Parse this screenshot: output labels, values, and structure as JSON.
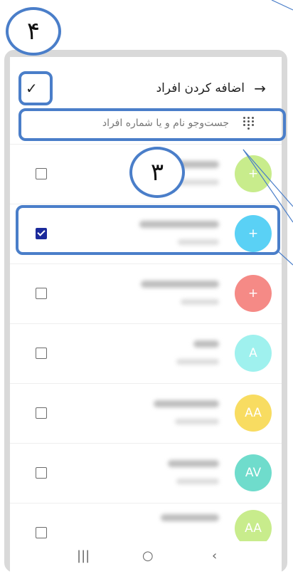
{
  "header": {
    "title": "اضافه کردن افراد",
    "back_icon": "→",
    "done_icon": "✓"
  },
  "search": {
    "placeholder": "جست‌وجو نام و یا شماره افراد"
  },
  "contacts": [
    {
      "initials": "+",
      "color": "#c8ec8c",
      "checked": false
    },
    {
      "initials": "+",
      "color": "#5ad1f5",
      "checked": true
    },
    {
      "initials": "+",
      "color": "#f58a86",
      "checked": false
    },
    {
      "initials": "A",
      "color": "#9ff1ee",
      "checked": false
    },
    {
      "initials": "AA",
      "color": "#f8dc61",
      "checked": false
    },
    {
      "initials": "AV",
      "color": "#6fdccc",
      "checked": false
    },
    {
      "initials": "AA",
      "color": "#c8ec8c",
      "checked": false
    }
  ],
  "annotations": {
    "label_4": "۴",
    "label_3": "۳"
  },
  "navbar": {
    "recents": "|||",
    "home": "○",
    "back": "‹"
  }
}
